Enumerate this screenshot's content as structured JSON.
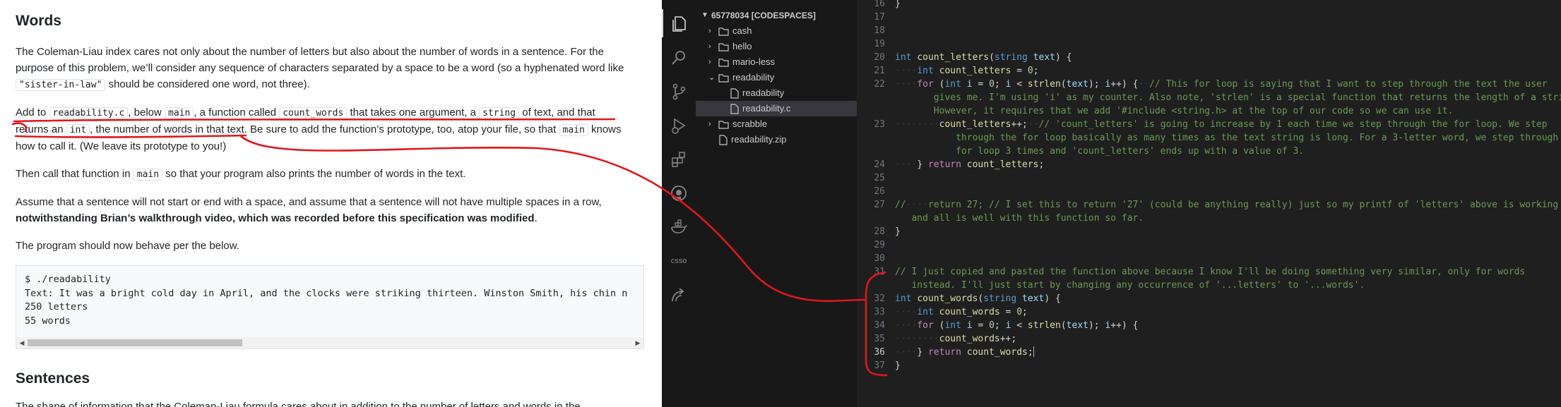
{
  "doc": {
    "words_heading": "Words",
    "p1": [
      "The Coleman-Liau index cares not only about the number of letters but also about the number of words in a sentence. For the",
      "purpose of this problem, we’ll consider any sequence of characters separated by a space to be a word (so a hyphenated word like",
      "\"sister-in-law\"",
      "should be considered one word, not three)."
    ],
    "p2": {
      "a": "Add to",
      "b": "readability.c",
      "c": ", below",
      "d": "main",
      "e": ", a function called",
      "f": "count_words",
      "g": "that takes one argument, a",
      "h": "string",
      "i": "of text, and that",
      "j": "returns an",
      "k": "int",
      "l": ", the number of words in that text. Be sure to add the function’s prototype, too, atop your file, so that",
      "m": "main",
      "n": "knows",
      "o": "how to call it. (We leave its prototype to you!)"
    },
    "p3": {
      "a": "Then call that function in",
      "b": "main",
      "c": "so that your program also prints the number of words in the text."
    },
    "p4": {
      "a": "Assume that a sentence will not start or end with a space, and assume that a sentence will not have multiple spaces in a row,",
      "b": "notwithstanding Brian’s walkthrough video, which was recorded before this specification was modified",
      "c": "."
    },
    "p5": "The program should now behave per the below.",
    "code_lines": [
      "$ ./readability",
      "Text: It was a bright cold day in April, and the clocks were striking thirteen. Winston Smith, his chin n",
      "250 letters",
      "55 words"
    ],
    "sentences_heading": "Sentences",
    "cut_line": "The shape of information that the Coleman-Liau formula cares about in addition to the number of letters and words in the"
  },
  "activity_bar": [
    "files-icon",
    "search-icon",
    "source-control-icon",
    "run-debug-icon",
    "extensions-icon",
    "github-icon",
    "docker-icon",
    "csso-icon",
    "remote-icon"
  ],
  "activity_text": {
    "csso": "csso"
  },
  "explorer": {
    "root": "65778034 [CODESPACES]",
    "items": [
      {
        "label": "cash",
        "type": "folder",
        "depth": 1,
        "open": false
      },
      {
        "label": "hello",
        "type": "folder",
        "depth": 1,
        "open": false
      },
      {
        "label": "mario-less",
        "type": "folder",
        "depth": 1,
        "open": false
      },
      {
        "label": "readability",
        "type": "folder",
        "depth": 1,
        "open": true
      },
      {
        "label": "readability",
        "type": "file",
        "depth": 2
      },
      {
        "label": "readability.c",
        "type": "file",
        "depth": 2,
        "selected": true
      },
      {
        "label": "scrabble",
        "type": "folder",
        "depth": 1,
        "open": false
      },
      {
        "label": "readability.zip",
        "type": "file",
        "depth": 1
      }
    ]
  },
  "editor": {
    "lines": [
      {
        "n": "16",
        "t": "}"
      },
      {
        "n": "17",
        "t": ""
      },
      {
        "n": "18",
        "t": ""
      },
      {
        "n": "19",
        "t": ""
      },
      {
        "n": "20",
        "t": "int count_letters(string text) {"
      },
      {
        "n": "21",
        "t": "····int count_letters = 0;"
      },
      {
        "n": "22",
        "t": "····for (int i = 0; i < strlen(text); i++) {··// This for loop is saying that I want to step through the text the user"
      },
      {
        "n": "",
        "t": "       gives me. I'm using 'i' as my counter. Also note, 'strlen' is a special function that returns the length of a string."
      },
      {
        "n": "",
        "t": "       However, it requires that we add '#include <string.h> at the top of our code so we can use it."
      },
      {
        "n": "23",
        "t": "········count_letters++;··// 'count_letters' is going to increase by 1 each time we step through the for loop. We step"
      },
      {
        "n": "",
        "t": "           through the for loop basically as many times as the text string is long. For a 3-letter word, we step through the"
      },
      {
        "n": "",
        "t": "           for loop 3 times and 'count_letters' ends up with a value of 3."
      },
      {
        "n": "24",
        "t": "····} return count_letters;"
      },
      {
        "n": "25",
        "t": ""
      },
      {
        "n": "26",
        "t": ""
      },
      {
        "n": "27",
        "t": "//····return 27; // I set this to return '27' (could be anything really) just so my printf of 'letters' above is working"
      },
      {
        "n": "",
        "t": "   and all is well with this function so far."
      },
      {
        "n": "28",
        "t": "}"
      },
      {
        "n": "29",
        "t": ""
      },
      {
        "n": "30",
        "t": ""
      },
      {
        "n": "31",
        "t": "// I just copied and pasted the function above because I know I'll be doing something very similar, only for words"
      },
      {
        "n": "",
        "t": "   instead. I'll just start by changing any occurrence of '...letters' to '...words'."
      },
      {
        "n": "32",
        "t": "int count_words(string text) {"
      },
      {
        "n": "33",
        "t": "····int count_words = 0;"
      },
      {
        "n": "34",
        "t": "····for (int i = 0; i < strlen(text); i++) {"
      },
      {
        "n": "35",
        "t": "········count_words++;"
      },
      {
        "n": "36",
        "t": "····} return count_words;",
        "current": true
      },
      {
        "n": "37",
        "t": "}"
      }
    ]
  },
  "colors": {
    "annotation": "#e0161c",
    "editor_bg": "#1f1f1f",
    "sidebar_bg": "#181818"
  }
}
